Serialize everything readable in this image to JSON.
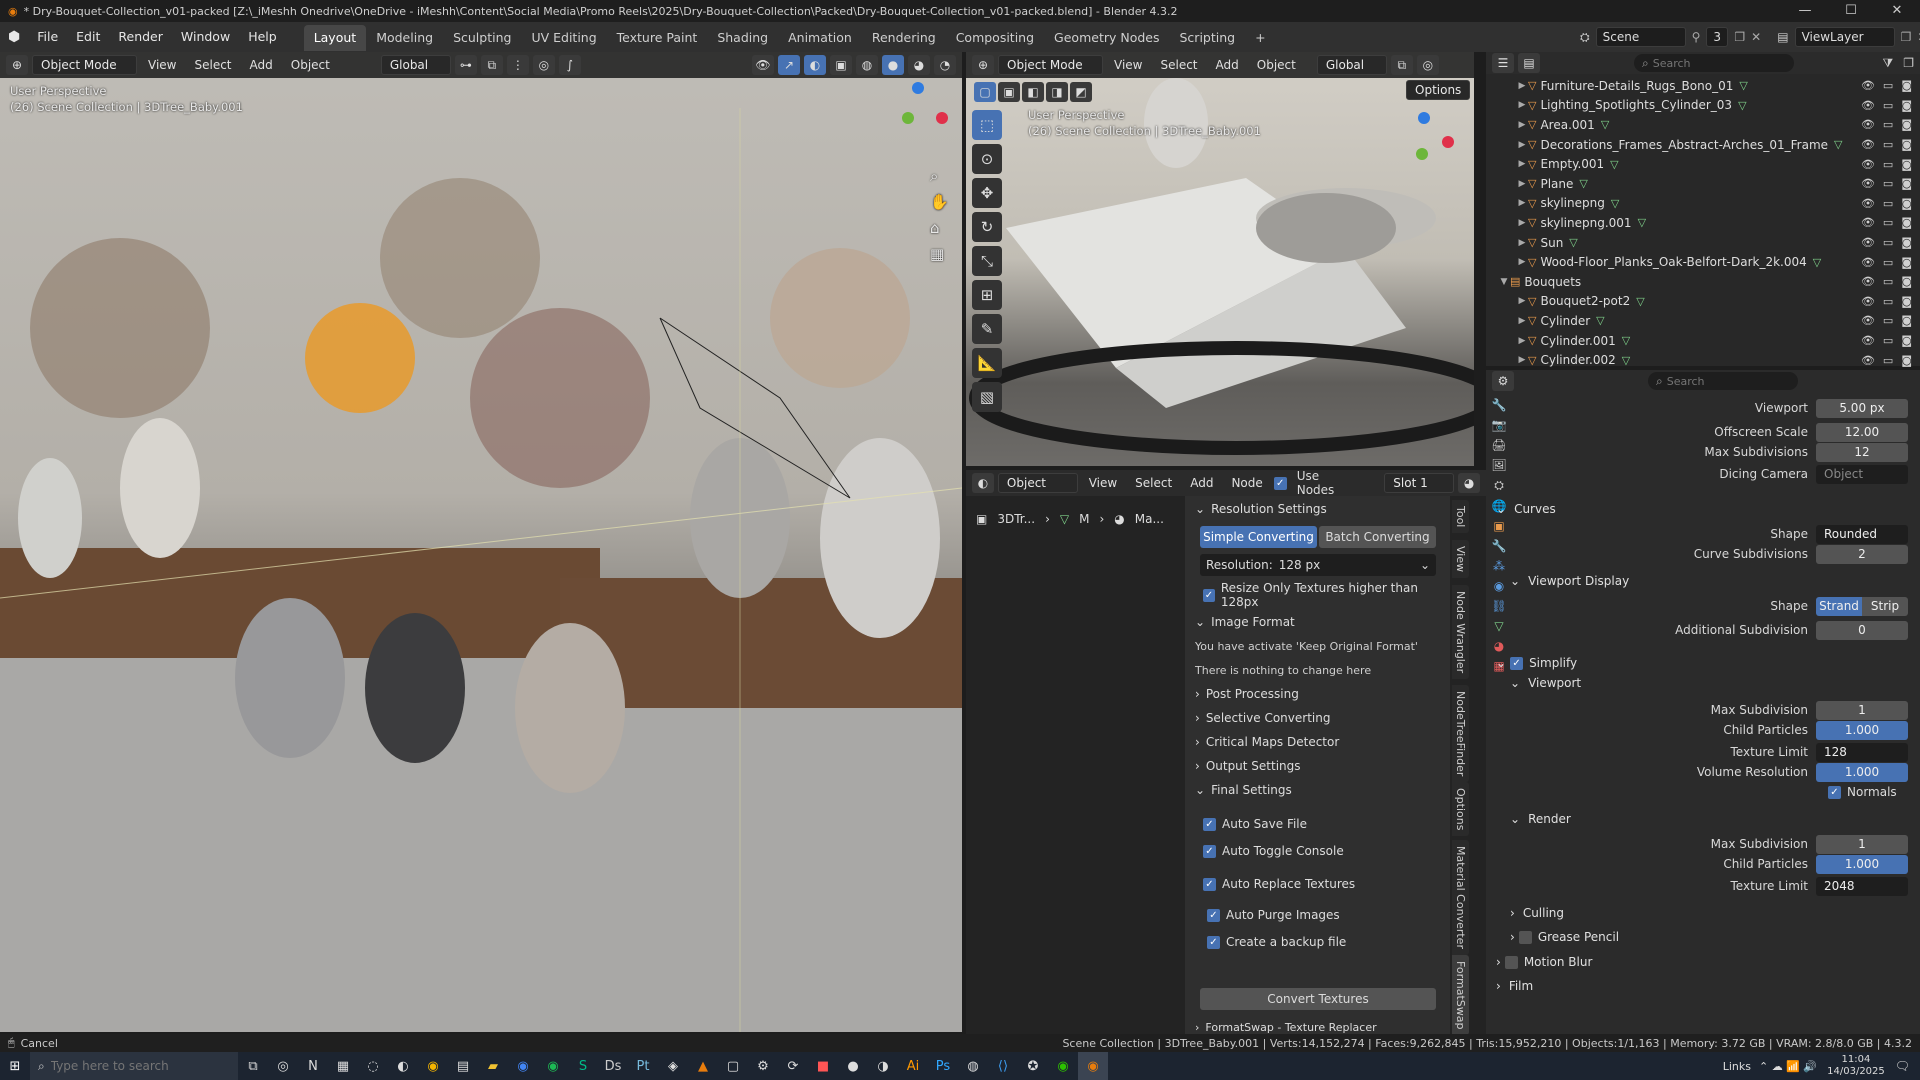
{
  "window": {
    "title": "* Dry-Bouquet-Collection_v01-packed [Z:\\_iMeshh Onedrive\\OneDrive - iMeshh\\Content\\Social Media\\Promo Reels\\2025\\Dry-Bouquet-Collection\\Packed\\Dry-Bouquet-Collection_v01-packed.blend] - Blender 4.3.2",
    "controls": [
      "—",
      "☐",
      "✕"
    ]
  },
  "menubar": {
    "menus": [
      "File",
      "Edit",
      "Render",
      "Window",
      "Help"
    ],
    "workspaces": [
      "Layout",
      "Modeling",
      "Sculpting",
      "UV Editing",
      "Texture Paint",
      "Shading",
      "Animation",
      "Rendering",
      "Compositing",
      "Geometry Nodes",
      "Scripting"
    ],
    "active_workspace": "Layout",
    "scene": "Scene",
    "scene_users": "3",
    "view_layer": "ViewLayer"
  },
  "viewport_left": {
    "mode": "Object Mode",
    "menus": [
      "View",
      "Select",
      "Add",
      "Object"
    ],
    "orientation": "Global",
    "perspective": "User Perspective",
    "collection": "(26) Scene Collection | 3DTree_Baby.001"
  },
  "viewport_right": {
    "mode": "Object Mode",
    "menus": [
      "View",
      "Select",
      "Add",
      "Object"
    ],
    "orientation": "Global",
    "options_label": "Options",
    "perspective": "User Perspective",
    "collection": "(26) Scene Collection | 3DTree_Baby.001"
  },
  "outliner": {
    "search_placeholder": "Search",
    "items": [
      {
        "name": "Furniture-Details_Rugs_Bono_01",
        "indent": 1
      },
      {
        "name": "Lighting_Spotlights_Cylinder_03",
        "indent": 1
      },
      {
        "name": "Area.001",
        "indent": 1
      },
      {
        "name": "Decorations_Frames_Abstract-Arches_01_Frame",
        "indent": 1
      },
      {
        "name": "Empty.001",
        "indent": 1
      },
      {
        "name": "Plane",
        "indent": 1
      },
      {
        "name": "skylinepng",
        "indent": 1
      },
      {
        "name": "skylinepng.001",
        "indent": 1
      },
      {
        "name": "Sun",
        "indent": 1
      },
      {
        "name": "Wood-Floor_Planks_Oak-Belfort-Dark_2k.004",
        "indent": 1
      },
      {
        "name": "Bouquets",
        "indent": 0
      },
      {
        "name": "Bouquet2-pot2",
        "indent": 1
      },
      {
        "name": "Cylinder",
        "indent": 1
      },
      {
        "name": "Cylinder.001",
        "indent": 1
      },
      {
        "name": "Cylinder.002",
        "indent": 1
      }
    ]
  },
  "properties": {
    "search_placeholder": "Search",
    "viewport_label": "Viewport",
    "viewport_value": "5.00 px",
    "offscreen_label": "Offscreen Scale",
    "offscreen_value": "12.00",
    "maxsub_label": "Max Subdivisions",
    "maxsub_value": "12",
    "dicing_label": "Dicing Camera",
    "dicing_placeholder": "Object",
    "curves_header": "Curves",
    "shape_label": "Shape",
    "shape_value": "Rounded Ribbons",
    "curve_sub_label": "Curve Subdivisions",
    "curve_sub_value": "2",
    "vp_display_header": "Viewport Display",
    "vp_shape_label": "Shape",
    "vp_shape_a": "Strand",
    "vp_shape_b": "Strip",
    "add_sub_label": "Additional Subdivision",
    "add_sub_value": "0",
    "simplify_header": "Simplify",
    "viewport_sub_header": "Viewport",
    "vp_maxsub_label": "Max Subdivision",
    "vp_maxsub_value": "1",
    "vp_child_label": "Child Particles",
    "vp_child_value": "1.000",
    "vp_tex_label": "Texture Limit",
    "vp_tex_value": "128",
    "vol_label": "Volume Resolution",
    "vol_value": "1.000",
    "normals_label": "Normals",
    "render_header": "Render",
    "r_maxsub_label": "Max Subdivision",
    "r_maxsub_value": "1",
    "r_child_label": "Child Particles",
    "r_child_value": "1.000",
    "r_tex_label": "Texture Limit",
    "r_tex_value": "2048",
    "culling_header": "Culling",
    "grease_header": "Grease Pencil",
    "motion_header": "Motion Blur",
    "film_header": "Film"
  },
  "node_editor": {
    "type": "Object",
    "menus": [
      "View",
      "Select",
      "Add",
      "Node"
    ],
    "use_nodes": "Use Nodes",
    "slot": "Slot 1",
    "breadcrumb": [
      "3DTr...",
      "M",
      "Ma..."
    ]
  },
  "addon": {
    "resolution_header": "Resolution Settings",
    "tab_simple": "Simple Converting",
    "tab_batch": "Batch Converting",
    "resolution_label": "Resolution:",
    "resolution_value": "128 px",
    "resize_only": "Resize Only Textures higher than 128px",
    "image_format": "Image Format",
    "note1": "You have activate 'Keep Original Format'",
    "note2": "There is nothing to change here",
    "post": "Post Processing",
    "selective": "Selective Converting",
    "critical": "Critical Maps Detector",
    "output": "Output Settings",
    "final": "Final Settings",
    "auto_save": "Auto Save File",
    "auto_toggle": "Auto Toggle Console",
    "auto_replace": "Auto Replace Textures",
    "auto_purge": "Auto Purge Images",
    "backup": "Create a backup file",
    "convert": "Convert Textures",
    "more": "FormatSwap - Texture Replacer",
    "vtabs": [
      "Tool",
      "View",
      "Node Wrangler",
      "NodeTreeFinder",
      "Options",
      "Material Converter",
      "FormatSwap"
    ]
  },
  "statusbar": {
    "left": "Cancel",
    "right": "Scene Collection | 3DTree_Baby.001 | Verts:14,152,274 | Faces:9,262,845 | Tris:15,952,210 | Objects:1/1,163 | Memory: 3.72 GB | VRAM: 2.8/8.0 GB | 4.3.2"
  },
  "taskbar": {
    "search_placeholder": "Type here to search",
    "links": "Links",
    "time": "11:04",
    "date": "14/03/2025"
  },
  "colors": {
    "accent": "#4772b3",
    "object": "#e99a4c",
    "mesh": "#7fd18a"
  }
}
